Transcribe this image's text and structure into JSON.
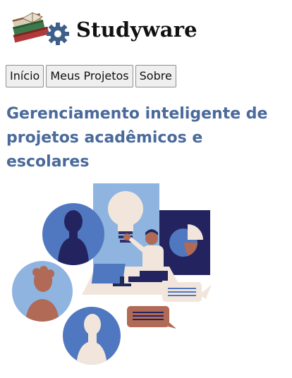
{
  "brand": {
    "name": "Studyware",
    "logo_icon": "books-gear-logo"
  },
  "nav": {
    "items": [
      {
        "label": "Início"
      },
      {
        "label": "Meus Projetos"
      },
      {
        "label": "Sobre"
      }
    ]
  },
  "hero": {
    "headline": "Gerenciamento inteligente de projetos acadêmicos e escolares",
    "illustration": "collaboration-illustration"
  },
  "colors": {
    "headline": "#4a6a9b",
    "blue_dark": "#4f78c1",
    "blue_light": "#8fb4e0",
    "navy": "#23245f",
    "brown": "#b06a55",
    "cream": "#f2e6dc"
  }
}
